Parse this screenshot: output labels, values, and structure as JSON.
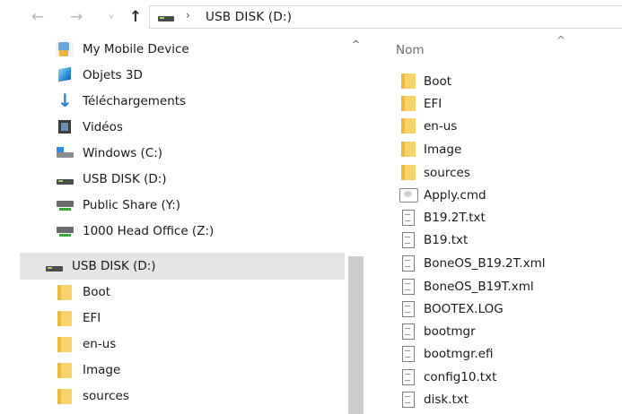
{
  "address_bar": {
    "path_label": "USB DISK (D:)",
    "separator": "›",
    "back_glyph": "←",
    "forward_glyph": "→",
    "recent_glyph": "∨",
    "up_glyph": "↑"
  },
  "nav_pane": {
    "items": [
      {
        "label": "My Mobile Device",
        "icon": "mobile-device-icon"
      },
      {
        "label": "Objets 3D",
        "icon": "3d-objects-icon"
      },
      {
        "label": "Téléchargements",
        "icon": "download-icon"
      },
      {
        "label": "Vidéos",
        "icon": "video-icon"
      },
      {
        "label": "Windows (C:)",
        "icon": "windows-drive-icon"
      },
      {
        "label": "USB DISK (D:)",
        "icon": "usb-drive-icon"
      },
      {
        "label": "Public Share (Y:)",
        "icon": "network-drive-icon"
      },
      {
        "label": "1000 Head Office (Z:)",
        "icon": "network-drive-icon"
      }
    ],
    "selected": {
      "label": "USB DISK (D:)",
      "icon": "usb-drive-icon"
    },
    "children": [
      {
        "label": "Boot",
        "icon": "folder-icon"
      },
      {
        "label": "EFI",
        "icon": "folder-icon"
      },
      {
        "label": "en-us",
        "icon": "folder-icon"
      },
      {
        "label": "Image",
        "icon": "folder-icon"
      },
      {
        "label": "sources",
        "icon": "folder-icon"
      }
    ],
    "scroll_up_glyph": "^"
  },
  "file_list": {
    "column_header": "Nom",
    "sort_glyph": "^",
    "items": [
      {
        "label": "Boot",
        "icon": "folder-icon"
      },
      {
        "label": "EFI",
        "icon": "folder-icon"
      },
      {
        "label": "en-us",
        "icon": "folder-icon"
      },
      {
        "label": "Image",
        "icon": "folder-icon"
      },
      {
        "label": "sources",
        "icon": "folder-icon"
      },
      {
        "label": "Apply.cmd",
        "icon": "cmd-file-icon"
      },
      {
        "label": "B19.2T.txt",
        "icon": "text-file-icon"
      },
      {
        "label": "B19.txt",
        "icon": "text-file-icon"
      },
      {
        "label": "BoneOS_B19.2T.xml",
        "icon": "text-file-icon"
      },
      {
        "label": "BoneOS_B19T.xml",
        "icon": "text-file-icon"
      },
      {
        "label": "BOOTEX.LOG",
        "icon": "text-file-icon"
      },
      {
        "label": "bootmgr",
        "icon": "text-file-icon"
      },
      {
        "label": "bootmgr.efi",
        "icon": "text-file-icon"
      },
      {
        "label": "config10.txt",
        "icon": "text-file-icon"
      },
      {
        "label": "disk.txt",
        "icon": "text-file-icon"
      }
    ]
  },
  "colors": {
    "selected_row": "#e5e5e5",
    "folder": "#f7d36b",
    "text": "#1a1a1a",
    "header_text": "#6d6d6d"
  }
}
